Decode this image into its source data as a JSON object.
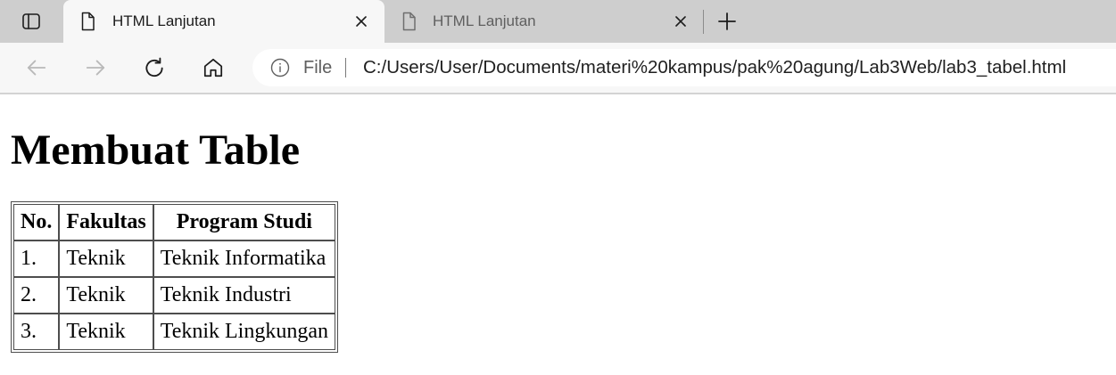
{
  "tabs": [
    {
      "title": "HTML Lanjutan",
      "active": true,
      "icon": "document-icon"
    },
    {
      "title": "HTML Lanjutan",
      "active": false,
      "icon": "document-icon"
    }
  ],
  "tab_strip": {
    "left_icon": "vertical-tabs-icon",
    "new_tab_icon": "plus-icon"
  },
  "navigation": {
    "back_enabled": false,
    "forward_enabled": false,
    "icons": [
      "back-arrow-icon",
      "forward-arrow-icon",
      "refresh-icon",
      "home-icon"
    ]
  },
  "address_bar": {
    "security_icon": "info-icon",
    "scheme_label": "File",
    "url": "C:/Users/User/Documents/materi%20kampus/pak%20agung/Lab3Web/lab3_tabel.html"
  },
  "page": {
    "heading": "Membuat Table",
    "table": {
      "headers": [
        "No.",
        "Fakultas",
        "Program Studi"
      ],
      "rows": [
        [
          "1.",
          "Teknik",
          "Teknik Informatika"
        ],
        [
          "2.",
          "Teknik",
          "Teknik Industri"
        ],
        [
          "3.",
          "Teknik",
          "Teknik Lingkungan"
        ]
      ]
    }
  },
  "colors": {
    "tab_strip_bg": "#cecece",
    "toolbar_bg": "#f7f7f7",
    "address_bar_bg": "#ffffff",
    "icon_color": "#1c1c1c",
    "disabled_icon_color": "#b9b9b9",
    "muted_text": "#5f5f5f",
    "table_border": "#4d4d4d"
  }
}
